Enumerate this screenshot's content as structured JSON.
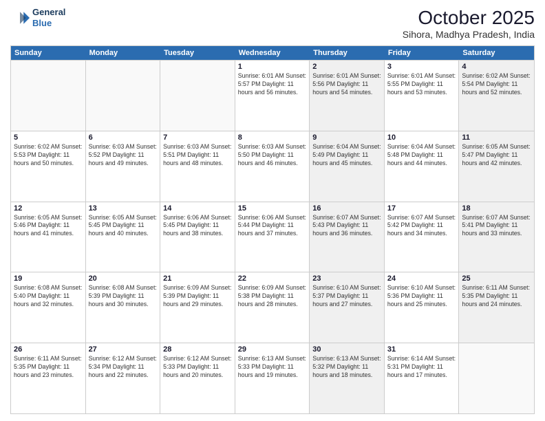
{
  "header": {
    "logo_line1": "General",
    "logo_line2": "Blue",
    "month": "October 2025",
    "location": "Sihora, Madhya Pradesh, India"
  },
  "weekdays": [
    "Sunday",
    "Monday",
    "Tuesday",
    "Wednesday",
    "Thursday",
    "Friday",
    "Saturday"
  ],
  "rows": [
    [
      {
        "day": "",
        "info": "",
        "shaded": false,
        "empty": true
      },
      {
        "day": "",
        "info": "",
        "shaded": false,
        "empty": true
      },
      {
        "day": "",
        "info": "",
        "shaded": false,
        "empty": true
      },
      {
        "day": "1",
        "info": "Sunrise: 6:01 AM\nSunset: 5:57 PM\nDaylight: 11 hours and 56 minutes.",
        "shaded": false,
        "empty": false
      },
      {
        "day": "2",
        "info": "Sunrise: 6:01 AM\nSunset: 5:56 PM\nDaylight: 11 hours and 54 minutes.",
        "shaded": true,
        "empty": false
      },
      {
        "day": "3",
        "info": "Sunrise: 6:01 AM\nSunset: 5:55 PM\nDaylight: 11 hours and 53 minutes.",
        "shaded": false,
        "empty": false
      },
      {
        "day": "4",
        "info": "Sunrise: 6:02 AM\nSunset: 5:54 PM\nDaylight: 11 hours and 52 minutes.",
        "shaded": true,
        "empty": false
      }
    ],
    [
      {
        "day": "5",
        "info": "Sunrise: 6:02 AM\nSunset: 5:53 PM\nDaylight: 11 hours and 50 minutes.",
        "shaded": false,
        "empty": false
      },
      {
        "day": "6",
        "info": "Sunrise: 6:03 AM\nSunset: 5:52 PM\nDaylight: 11 hours and 49 minutes.",
        "shaded": false,
        "empty": false
      },
      {
        "day": "7",
        "info": "Sunrise: 6:03 AM\nSunset: 5:51 PM\nDaylight: 11 hours and 48 minutes.",
        "shaded": false,
        "empty": false
      },
      {
        "day": "8",
        "info": "Sunrise: 6:03 AM\nSunset: 5:50 PM\nDaylight: 11 hours and 46 minutes.",
        "shaded": false,
        "empty": false
      },
      {
        "day": "9",
        "info": "Sunrise: 6:04 AM\nSunset: 5:49 PM\nDaylight: 11 hours and 45 minutes.",
        "shaded": true,
        "empty": false
      },
      {
        "day": "10",
        "info": "Sunrise: 6:04 AM\nSunset: 5:48 PM\nDaylight: 11 hours and 44 minutes.",
        "shaded": false,
        "empty": false
      },
      {
        "day": "11",
        "info": "Sunrise: 6:05 AM\nSunset: 5:47 PM\nDaylight: 11 hours and 42 minutes.",
        "shaded": true,
        "empty": false
      }
    ],
    [
      {
        "day": "12",
        "info": "Sunrise: 6:05 AM\nSunset: 5:46 PM\nDaylight: 11 hours and 41 minutes.",
        "shaded": false,
        "empty": false
      },
      {
        "day": "13",
        "info": "Sunrise: 6:05 AM\nSunset: 5:45 PM\nDaylight: 11 hours and 40 minutes.",
        "shaded": false,
        "empty": false
      },
      {
        "day": "14",
        "info": "Sunrise: 6:06 AM\nSunset: 5:45 PM\nDaylight: 11 hours and 38 minutes.",
        "shaded": false,
        "empty": false
      },
      {
        "day": "15",
        "info": "Sunrise: 6:06 AM\nSunset: 5:44 PM\nDaylight: 11 hours and 37 minutes.",
        "shaded": false,
        "empty": false
      },
      {
        "day": "16",
        "info": "Sunrise: 6:07 AM\nSunset: 5:43 PM\nDaylight: 11 hours and 36 minutes.",
        "shaded": true,
        "empty": false
      },
      {
        "day": "17",
        "info": "Sunrise: 6:07 AM\nSunset: 5:42 PM\nDaylight: 11 hours and 34 minutes.",
        "shaded": false,
        "empty": false
      },
      {
        "day": "18",
        "info": "Sunrise: 6:07 AM\nSunset: 5:41 PM\nDaylight: 11 hours and 33 minutes.",
        "shaded": true,
        "empty": false
      }
    ],
    [
      {
        "day": "19",
        "info": "Sunrise: 6:08 AM\nSunset: 5:40 PM\nDaylight: 11 hours and 32 minutes.",
        "shaded": false,
        "empty": false
      },
      {
        "day": "20",
        "info": "Sunrise: 6:08 AM\nSunset: 5:39 PM\nDaylight: 11 hours and 30 minutes.",
        "shaded": false,
        "empty": false
      },
      {
        "day": "21",
        "info": "Sunrise: 6:09 AM\nSunset: 5:39 PM\nDaylight: 11 hours and 29 minutes.",
        "shaded": false,
        "empty": false
      },
      {
        "day": "22",
        "info": "Sunrise: 6:09 AM\nSunset: 5:38 PM\nDaylight: 11 hours and 28 minutes.",
        "shaded": false,
        "empty": false
      },
      {
        "day": "23",
        "info": "Sunrise: 6:10 AM\nSunset: 5:37 PM\nDaylight: 11 hours and 27 minutes.",
        "shaded": true,
        "empty": false
      },
      {
        "day": "24",
        "info": "Sunrise: 6:10 AM\nSunset: 5:36 PM\nDaylight: 11 hours and 25 minutes.",
        "shaded": false,
        "empty": false
      },
      {
        "day": "25",
        "info": "Sunrise: 6:11 AM\nSunset: 5:35 PM\nDaylight: 11 hours and 24 minutes.",
        "shaded": true,
        "empty": false
      }
    ],
    [
      {
        "day": "26",
        "info": "Sunrise: 6:11 AM\nSunset: 5:35 PM\nDaylight: 11 hours and 23 minutes.",
        "shaded": false,
        "empty": false
      },
      {
        "day": "27",
        "info": "Sunrise: 6:12 AM\nSunset: 5:34 PM\nDaylight: 11 hours and 22 minutes.",
        "shaded": false,
        "empty": false
      },
      {
        "day": "28",
        "info": "Sunrise: 6:12 AM\nSunset: 5:33 PM\nDaylight: 11 hours and 20 minutes.",
        "shaded": false,
        "empty": false
      },
      {
        "day": "29",
        "info": "Sunrise: 6:13 AM\nSunset: 5:33 PM\nDaylight: 11 hours and 19 minutes.",
        "shaded": false,
        "empty": false
      },
      {
        "day": "30",
        "info": "Sunrise: 6:13 AM\nSunset: 5:32 PM\nDaylight: 11 hours and 18 minutes.",
        "shaded": true,
        "empty": false
      },
      {
        "day": "31",
        "info": "Sunrise: 6:14 AM\nSunset: 5:31 PM\nDaylight: 11 hours and 17 minutes.",
        "shaded": false,
        "empty": false
      },
      {
        "day": "",
        "info": "",
        "shaded": true,
        "empty": true
      }
    ]
  ]
}
